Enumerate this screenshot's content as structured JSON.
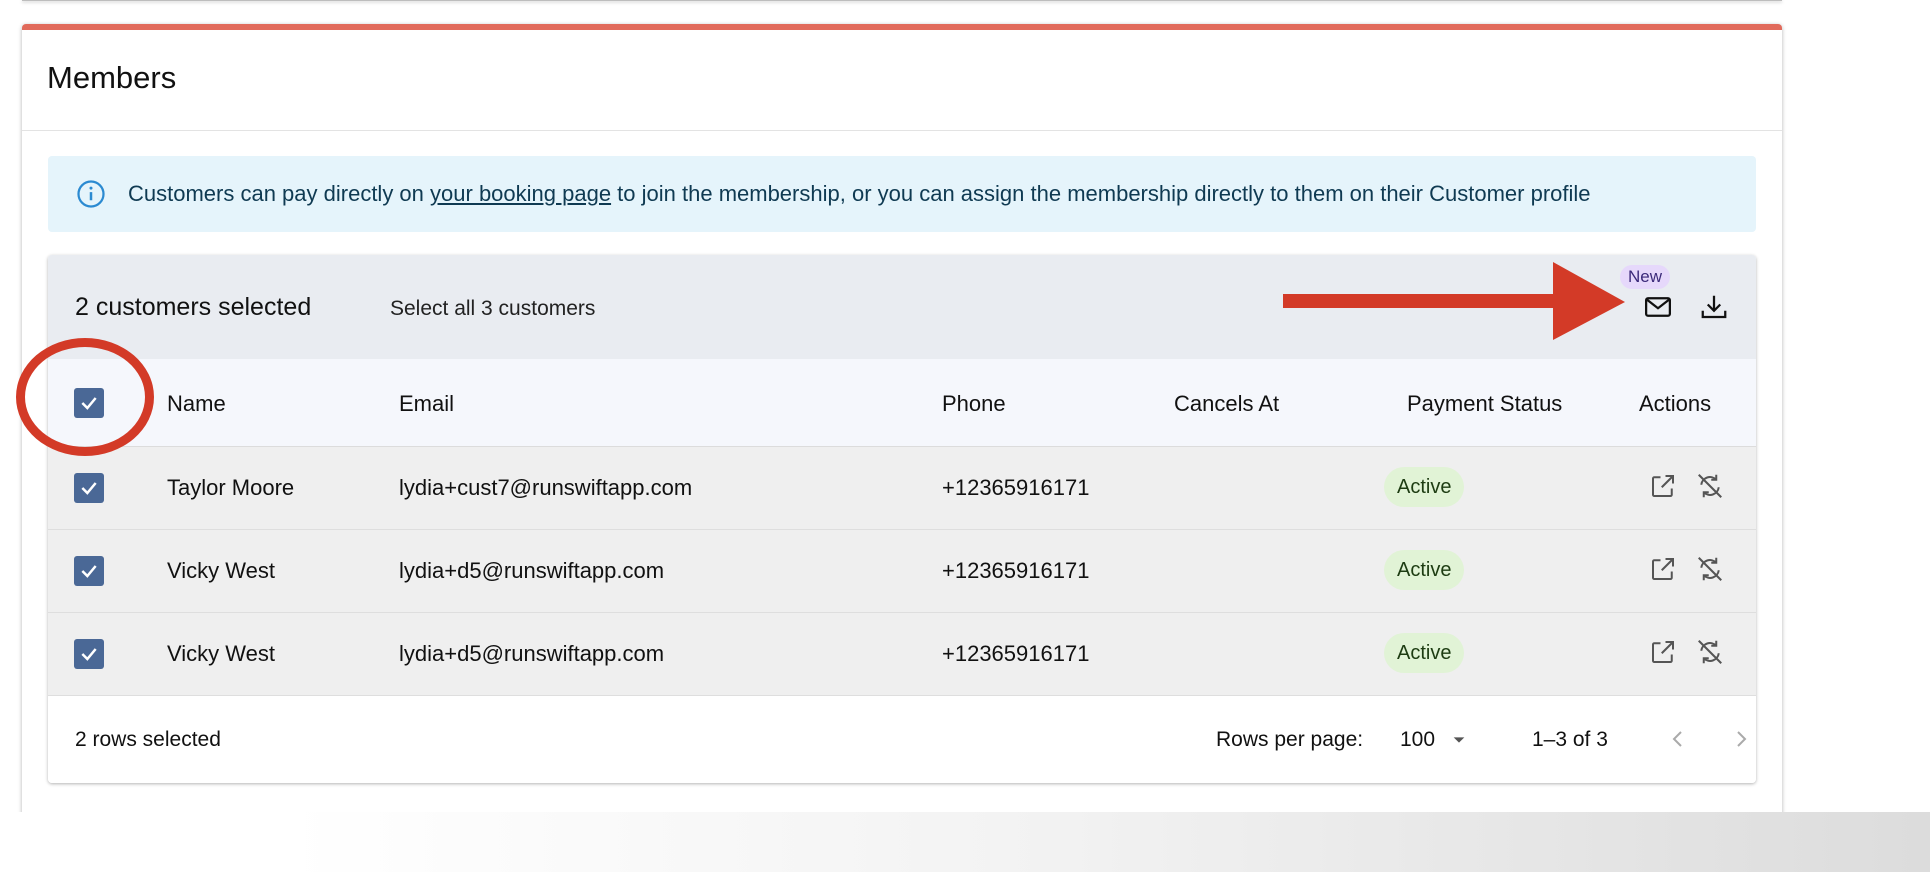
{
  "card": {
    "title": "Members"
  },
  "info_alert": {
    "icon": "info-icon",
    "text_before": "Customers can pay directly on ",
    "link_text": "your booking page",
    "text_after": " to join the membership, or you can assign the membership directly to them on their Customer profile"
  },
  "toolbar": {
    "selected_count": "2 customers selected",
    "select_all": "Select all 3 customers",
    "new_badge": "New",
    "actions": [
      "email-icon",
      "download-icon"
    ]
  },
  "table": {
    "columns": [
      "Name",
      "Email",
      "Phone",
      "Cancels At",
      "Payment Status",
      "Actions"
    ],
    "rows": [
      {
        "name": "Taylor Moore",
        "email": "lydia+cust7@runswiftapp.com",
        "phone": "+12365916171",
        "cancels_at": "",
        "payment_status": "Active",
        "checked": true
      },
      {
        "name": "Vicky West",
        "email": "lydia+d5@runswiftapp.com",
        "phone": "+12365916171",
        "cancels_at": "",
        "payment_status": "Active",
        "checked": true
      },
      {
        "name": "Vicky West",
        "email": "lydia+d5@runswiftapp.com",
        "phone": "+12365916171",
        "cancels_at": "",
        "payment_status": "Active",
        "checked": true
      }
    ]
  },
  "footer": {
    "rows_selected": "2 rows selected",
    "rows_per_page_label": "Rows per page:",
    "rows_per_page_value": "100",
    "range": "1–3 of 3"
  },
  "colors": {
    "accent_top": "#e16a5b",
    "checkbox": "#4a6896",
    "annotation": "#d33a27",
    "status_chip": "#e1f3d6",
    "info_bg": "#e5f4fb",
    "badge": "#e6d8fb"
  }
}
